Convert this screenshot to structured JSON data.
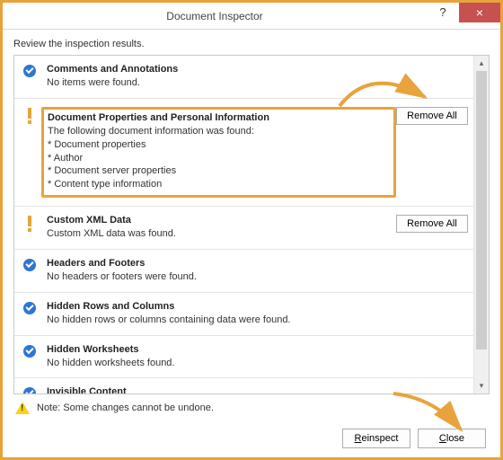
{
  "window": {
    "title": "Document Inspector",
    "help_tooltip": "?",
    "close_tooltip": "×"
  },
  "instruction": "Review the inspection results.",
  "sections": [
    {
      "status": "ok",
      "title": "Comments and Annotations",
      "desc": "No items were found."
    },
    {
      "status": "warn",
      "title": "Document Properties and Personal Information",
      "desc_intro": "The following document information was found:",
      "items": [
        "Document properties",
        "Author",
        "Document server properties",
        "Content type information"
      ],
      "action": "Remove All",
      "highlighted": true
    },
    {
      "status": "warn",
      "title": "Custom XML Data",
      "desc": "Custom XML data was found.",
      "action": "Remove All"
    },
    {
      "status": "ok",
      "title": "Headers and Footers",
      "desc": "No headers or footers were found."
    },
    {
      "status": "ok",
      "title": "Hidden Rows and Columns",
      "desc": "No hidden rows or columns containing data were found."
    },
    {
      "status": "ok",
      "title": "Hidden Worksheets",
      "desc": "No hidden worksheets found."
    },
    {
      "status": "ok",
      "title": "Invisible Content",
      "desc": ""
    }
  ],
  "note": "Note: Some changes cannot be undone.",
  "buttons": {
    "reinspect": "Reinspect",
    "close_pre": "",
    "close_ul": "C",
    "close_post": "lose"
  }
}
